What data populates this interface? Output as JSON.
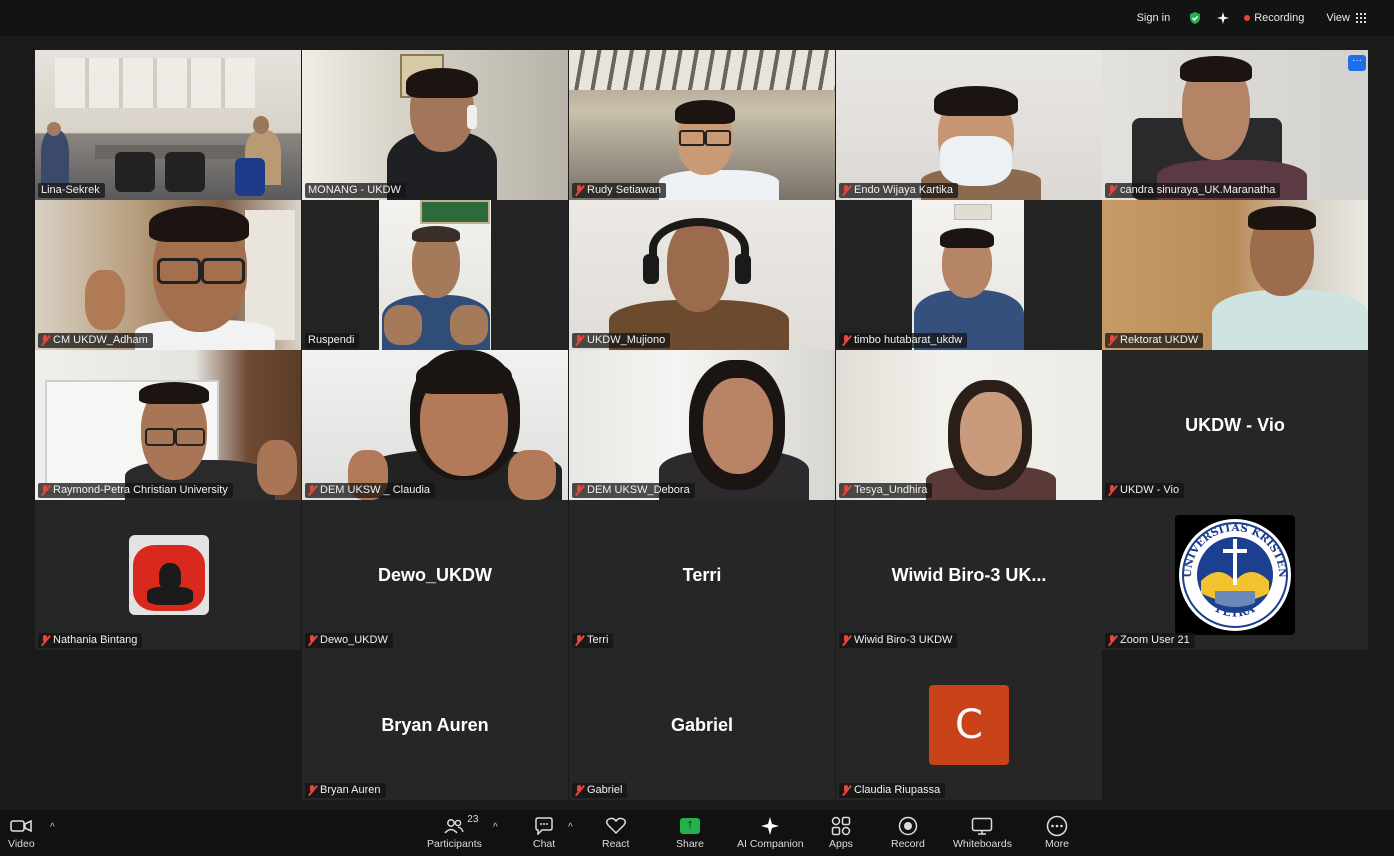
{
  "topbar": {
    "signin": "Sign in",
    "recording": "Recording",
    "view": "View",
    "recording_color": "#e8453c",
    "shield_color": "#22b14c"
  },
  "tiles": [
    {
      "name": "Lina-Sekrek",
      "muted": false
    },
    {
      "name": "MONANG - UKDW",
      "muted": false,
      "active": true
    },
    {
      "name": "Rudy Setiawan",
      "muted": true
    },
    {
      "name": "Endo Wijaya Kartika",
      "muted": true
    },
    {
      "name": "candra sinuraya_UK.Maranatha",
      "muted": true,
      "more": "···"
    },
    {
      "name": "CM UKDW_Adham",
      "muted": true
    },
    {
      "name": "Ruspendi",
      "muted": false
    },
    {
      "name": "UKDW_Mujiono",
      "muted": true
    },
    {
      "name": "timbo hutabarat_ukdw",
      "muted": true
    },
    {
      "name": "Rektorat UKDW",
      "muted": true
    },
    {
      "name": "Raymond-Petra Christian University",
      "muted": true
    },
    {
      "name": "DEM UKSW _ Claudia",
      "muted": true
    },
    {
      "name": "DEM UKSW_Debora",
      "muted": true
    },
    {
      "name": "Tesya_Undhira",
      "muted": true
    },
    {
      "name": "UKDW - Vio",
      "muted": true,
      "display": "UKDW - Vio"
    },
    {
      "name": "Nathania Bintang",
      "muted": true
    },
    {
      "name": "Dewo_UKDW",
      "muted": true,
      "display": "Dewo_UKDW"
    },
    {
      "name": "Terri",
      "muted": true,
      "display": "Terri"
    },
    {
      "name": "Wiwid Biro-3 UKDW",
      "muted": true,
      "display": "Wiwid Biro-3 UK..."
    },
    {
      "name": "Zoom User 21",
      "muted": true
    },
    {
      "name": "Bryan Auren",
      "muted": true,
      "display": "Bryan Auren"
    },
    {
      "name": "Gabriel",
      "muted": true,
      "display": "Gabriel"
    },
    {
      "name": "Claudia Riupassa",
      "muted": true,
      "avatar_letter": "C",
      "avatar_color": "#c9421a"
    }
  ],
  "logo": {
    "text_top": "UNIVERSITAS KRISTEN",
    "text_bottom": "PETRA",
    "primary_color": "#1d3f8f",
    "accent_color": "#f2c230"
  },
  "toolbar": {
    "video": "Video",
    "participants": "Participants",
    "participants_count": "23",
    "chat": "Chat",
    "react": "React",
    "share": "Share",
    "ai": "AI Companion",
    "apps": "Apps",
    "record": "Record",
    "whiteboards": "Whiteboards",
    "more": "More"
  }
}
